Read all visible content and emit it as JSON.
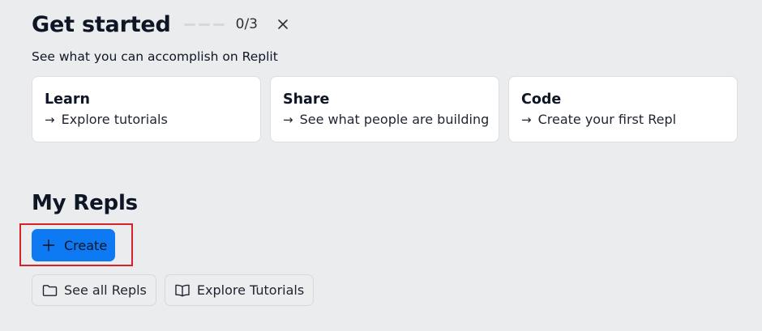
{
  "get_started": {
    "title": "Get started",
    "progress_text": "0/3",
    "progress_completed": 0,
    "progress_total": 3,
    "subtitle": "See what you can accomplish on Replit",
    "close_icon": "close-icon"
  },
  "cards": [
    {
      "title": "Learn",
      "link": "Explore tutorials",
      "arrow": "→"
    },
    {
      "title": "Share",
      "link": "See what people are building",
      "arrow": "→"
    },
    {
      "title": "Code",
      "link": "Create your first Repl",
      "arrow": "→"
    }
  ],
  "my_repls": {
    "title": "My Repls",
    "create_label": "Create",
    "create_icon": "plus-icon",
    "see_all_label": "See all Repls",
    "see_all_icon": "folder-icon",
    "explore_label": "Explore Tutorials",
    "explore_icon": "book-icon"
  },
  "colors": {
    "background": "#EBECEE",
    "primary": "#0D79F2",
    "highlight": "#D7222A",
    "card_bg": "#FFFFFF"
  }
}
